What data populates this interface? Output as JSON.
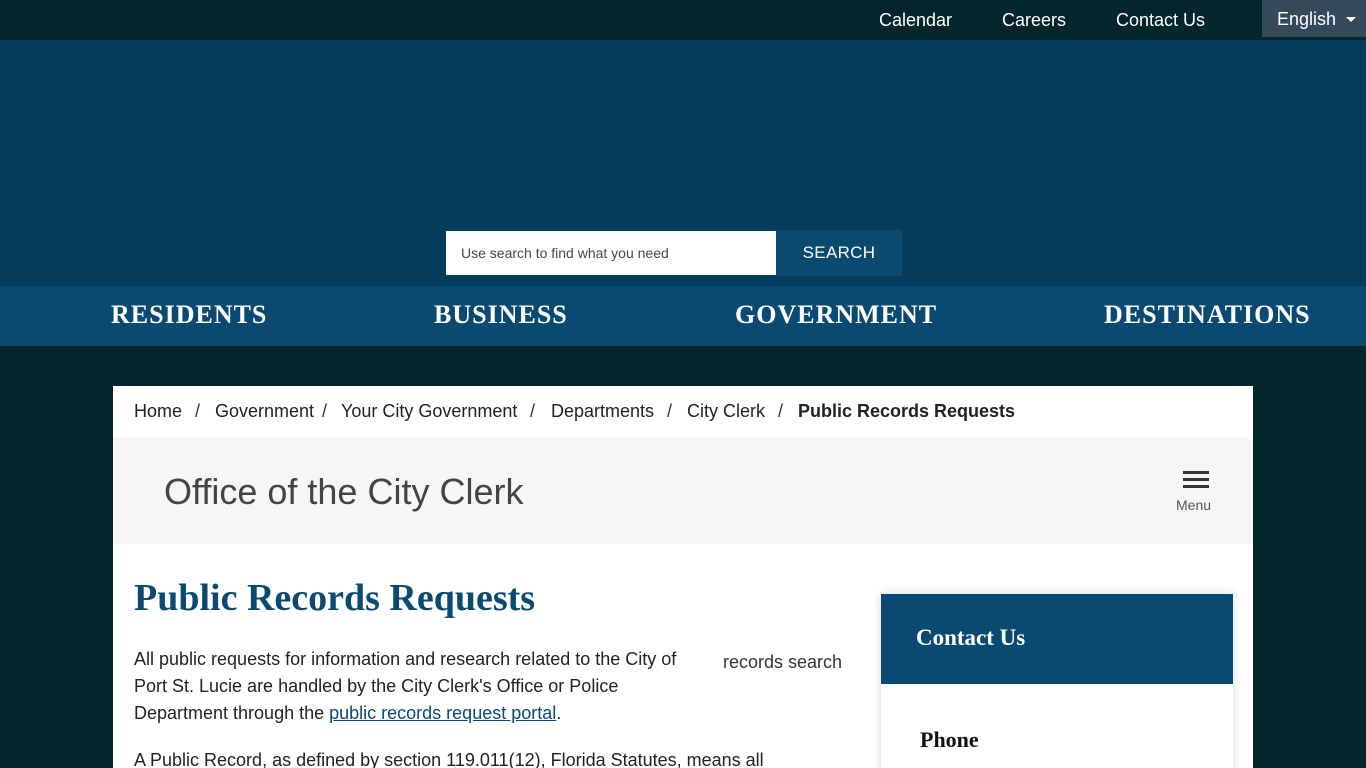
{
  "utility": {
    "links": [
      "Calendar",
      "Careers",
      "Contact Us"
    ],
    "language": "English"
  },
  "search": {
    "placeholder": "Use search to find what you need",
    "button": "SEARCH"
  },
  "main_nav": [
    "RESIDENTS",
    "BUSINESS",
    "GOVERNMENT",
    "DESTINATIONS"
  ],
  "breadcrumb": {
    "items": [
      "Home",
      "Government",
      "Your City Government",
      "Departments",
      "City Clerk"
    ],
    "current": "Public Records Requests",
    "separator": "/"
  },
  "department": {
    "title": "Office of the City Clerk",
    "menu_label": "Menu"
  },
  "content": {
    "title": "Public Records Requests",
    "para1_text": "All public requests for information and research related to the City of Port St. Lucie are handled by the City Clerk's Office or Police Department through the ",
    "para1_link": "public records request portal",
    "para1_end": ".",
    "para2_text": "A Public Record, as defined by section 119.011(12), Florida Statutes, means all",
    "image_alt": "records search"
  },
  "sidebar": {
    "title": "Contact Us",
    "phone_heading": "Phone"
  },
  "colors": {
    "dark_bg": "#03262d",
    "hero": "#073d5c",
    "nav": "#0a4a72",
    "accent": "#0a4a72"
  }
}
